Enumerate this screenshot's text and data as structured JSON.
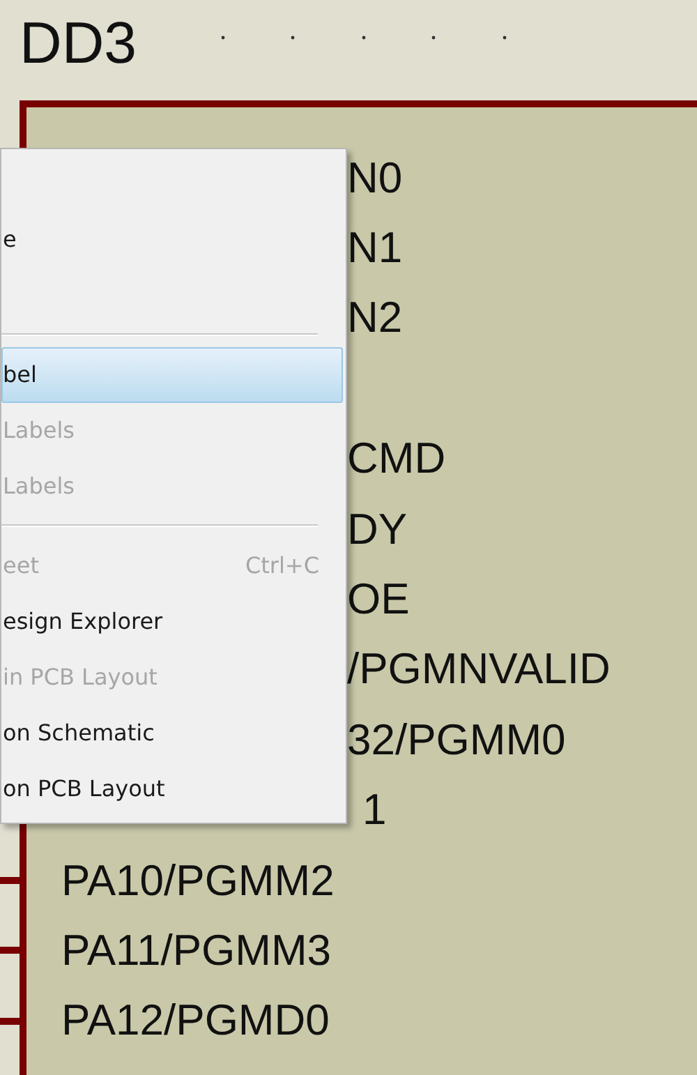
{
  "component": {
    "reference": "DD3",
    "pins_beside_menu": [
      {
        "label": "N0"
      },
      {
        "label": "N1"
      },
      {
        "label": "N2"
      },
      {
        "label": "CMD"
      },
      {
        "label": "DY"
      },
      {
        "label": "OE"
      },
      {
        "label": "/PGMNVALID"
      },
      {
        "label": "32/PGMM0"
      },
      {
        "label": "1"
      }
    ],
    "pins": [
      {
        "label": "PA10/PGMM2"
      },
      {
        "label": "PA11/PGMM3"
      },
      {
        "label": "PA12/PGMD0"
      }
    ]
  },
  "context_menu": {
    "items": [
      {
        "kind": "item",
        "label": "e",
        "selected": false,
        "disabled": false
      },
      {
        "kind": "separator"
      },
      {
        "kind": "item",
        "label": "bel",
        "selected": true,
        "disabled": false
      },
      {
        "kind": "item",
        "label": "Labels",
        "selected": false,
        "disabled": true
      },
      {
        "kind": "item",
        "label": "Labels",
        "selected": false,
        "disabled": true
      },
      {
        "kind": "separator"
      },
      {
        "kind": "item",
        "label": "eet",
        "shortcut": "Ctrl+C",
        "selected": false,
        "disabled": true
      },
      {
        "kind": "item",
        "label": "esign Explorer",
        "selected": false,
        "disabled": false
      },
      {
        "kind": "item",
        "label": "in PCB Layout",
        "selected": false,
        "disabled": true
      },
      {
        "kind": "item",
        "label": "on Schematic",
        "selected": false,
        "disabled": false
      },
      {
        "kind": "item",
        "label": "on PCB Layout",
        "selected": false,
        "disabled": false
      }
    ]
  }
}
